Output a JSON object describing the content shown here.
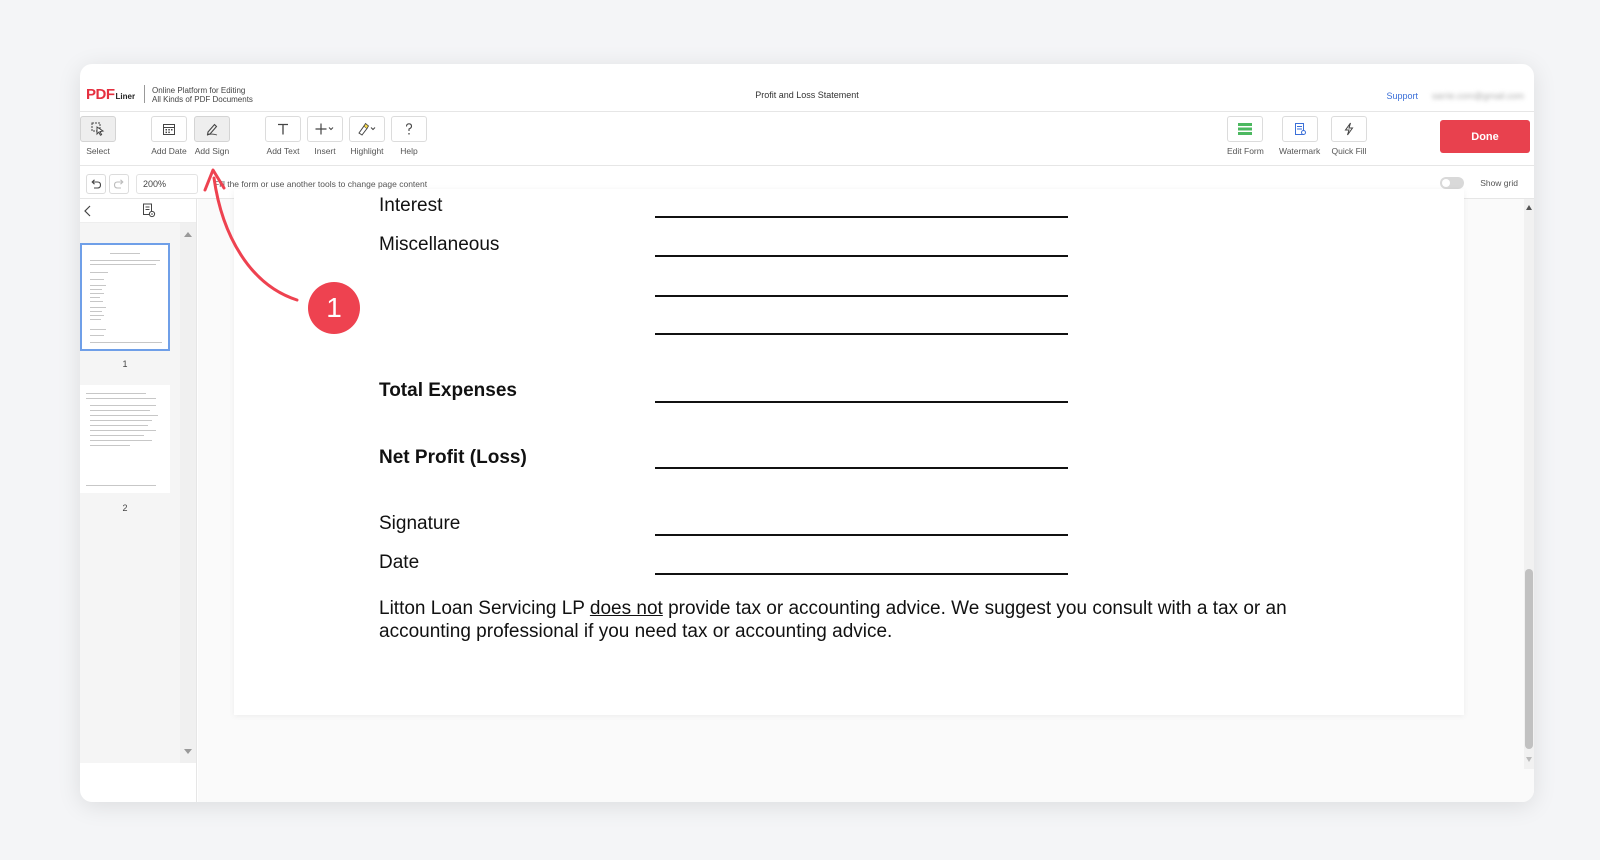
{
  "header": {
    "logo_pdf": "PDF",
    "logo_liner": "Liner",
    "tagline_line1": "Online Platform for Editing",
    "tagline_line2": "All Kinds of PDF Documents",
    "document_title": "Profit and Loss Statement",
    "support_label": "Support",
    "email": "sarrie.com@gmail.com"
  },
  "toolbar": {
    "left_tools": [
      {
        "label": "Select",
        "icon": "cursor-select-icon"
      },
      {
        "label": "Add Date",
        "icon": "calendar-icon"
      },
      {
        "label": "Add Sign",
        "icon": "pen-sign-icon"
      },
      {
        "label": "Add Text",
        "icon": "text-t-icon"
      },
      {
        "label": "Insert",
        "icon": "plus-icon"
      },
      {
        "label": "Highlight",
        "icon": "highlighter-icon"
      },
      {
        "label": "Help",
        "icon": "question-icon"
      }
    ],
    "right_tools": [
      {
        "label": "Edit Form",
        "icon": "form-icon"
      },
      {
        "label": "Watermark",
        "icon": "watermark-icon"
      },
      {
        "label": "Quick Fill",
        "icon": "lightning-icon"
      }
    ],
    "done_label": "Done",
    "active_tool": "Add Sign"
  },
  "subbar": {
    "zoom": "200%",
    "hint": "Fill the form or use another tools to change page content",
    "show_grid_label": "Show grid"
  },
  "sidebar": {
    "pages": [
      "1",
      "2"
    ]
  },
  "document": {
    "rows": [
      {
        "label": "Interest",
        "bold": false
      },
      {
        "label": "Miscellaneous",
        "bold": false
      },
      {
        "label": "",
        "bold": false
      },
      {
        "label": "",
        "bold": false
      },
      {
        "label": "Total Expenses",
        "bold": true
      },
      {
        "label": "Net Profit (Loss)",
        "bold": true
      },
      {
        "label": "Signature",
        "bold": false
      },
      {
        "label": "Date",
        "bold": false
      }
    ],
    "disclaimer_before": "Litton Loan Servicing LP ",
    "disclaimer_underlined": "does not",
    "disclaimer_after": " provide tax or accounting advice.  We suggest you consult with a tax or an accounting professional if you need tax or accounting advice."
  },
  "annotation": {
    "step_number": "1",
    "color": "#ee4250"
  },
  "colors": {
    "brand_red": "#e53040",
    "done_button": "#e8414e",
    "link_blue": "#3a6fd8",
    "selection_blue": "#6f9fe8",
    "form_green": "#4cb860"
  }
}
